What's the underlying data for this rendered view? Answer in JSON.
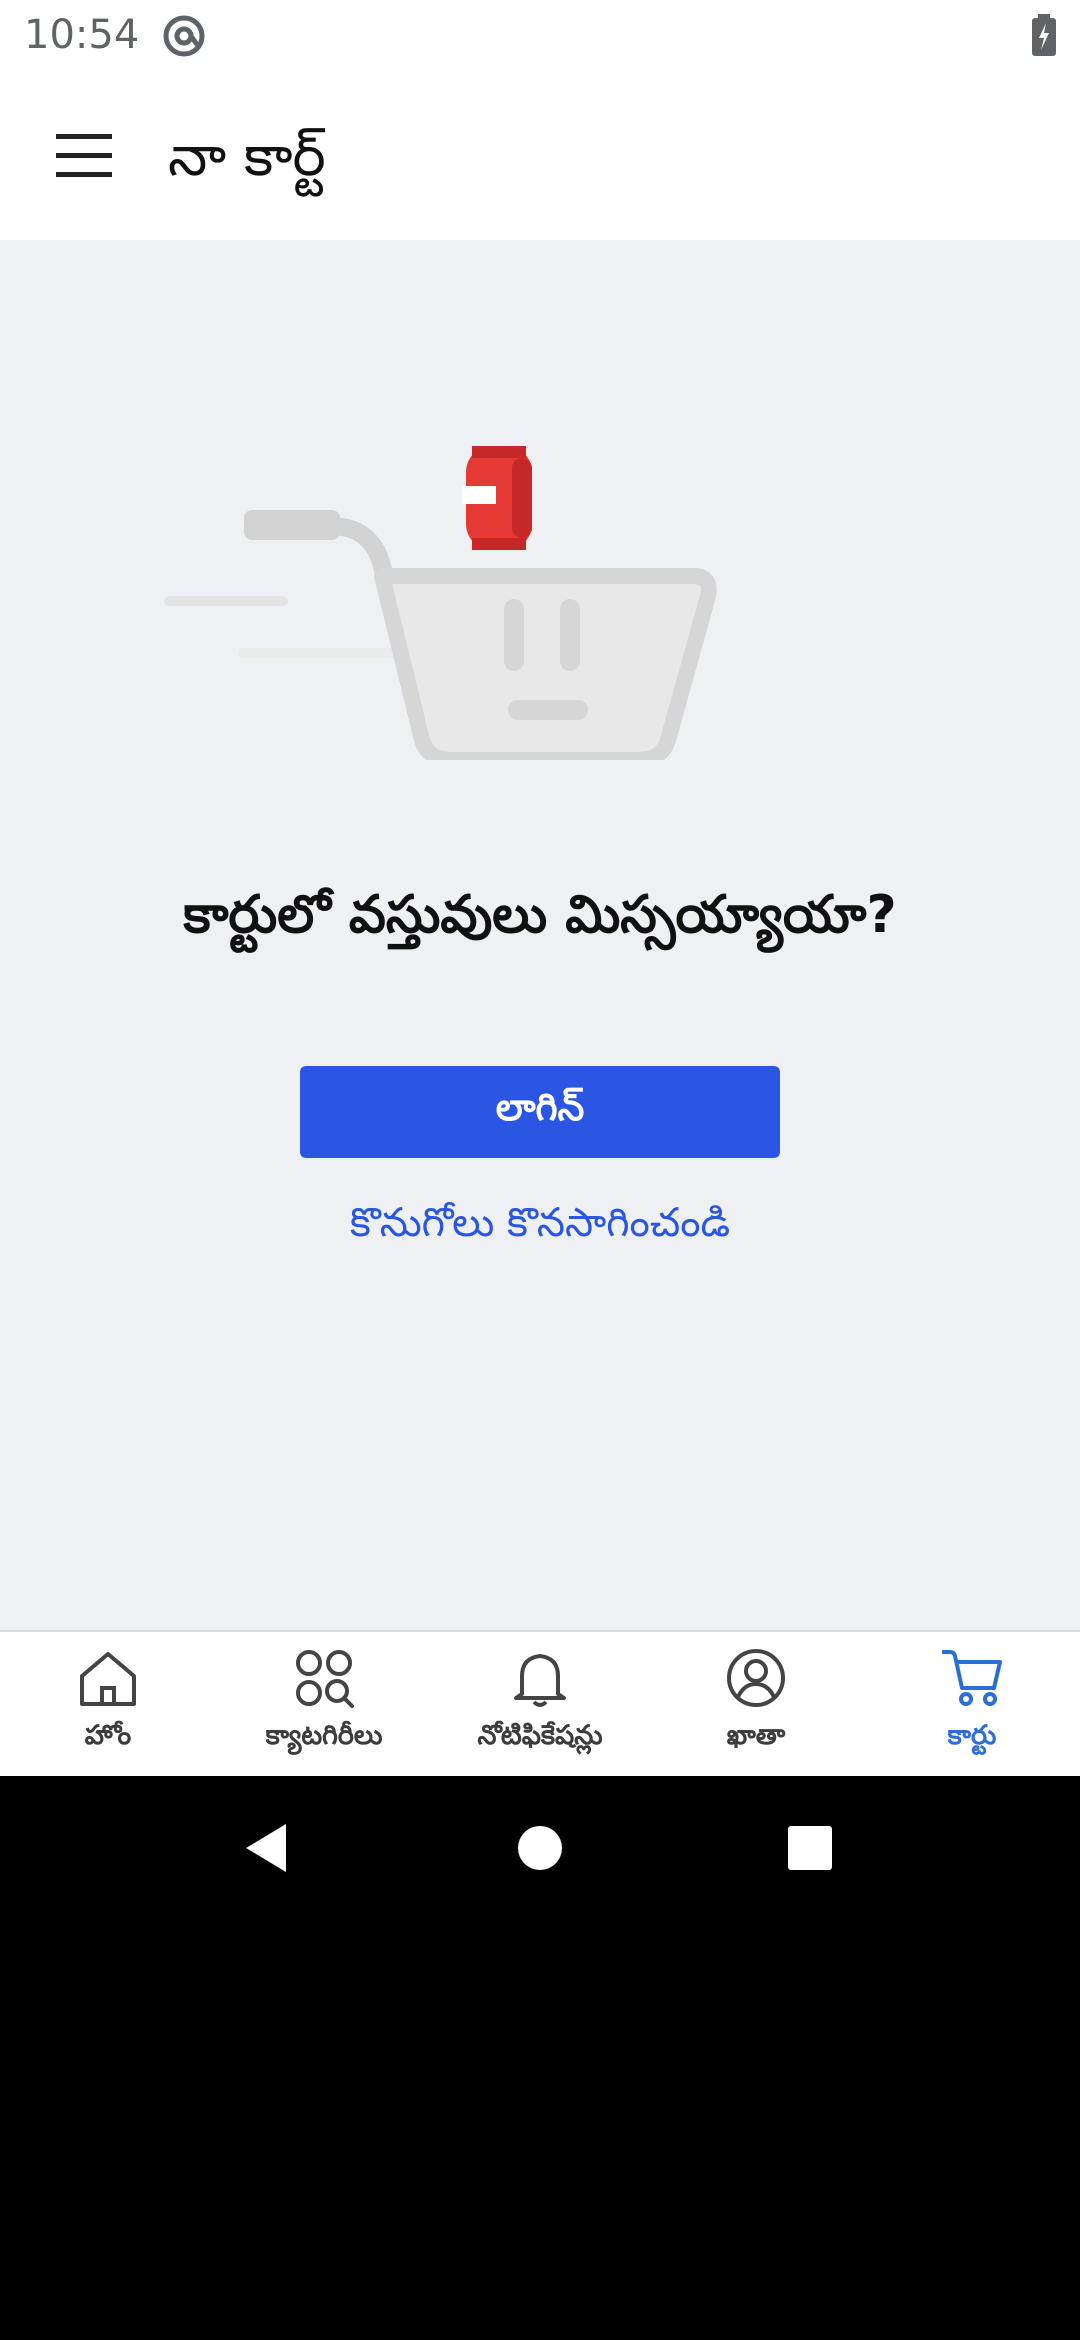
{
  "status_bar": {
    "time": "10:54",
    "app_icon": "at-sign-icon",
    "battery_icon": "battery-charging-icon"
  },
  "app_bar": {
    "menu_icon": "hamburger-menu-icon",
    "title": "నా కార్ట్"
  },
  "empty_state": {
    "illustration": "empty-shopping-cart-illustration",
    "heading": "కార్టులో వస్తువులు మిస్సయ్యాయా?",
    "login_label": "లాగిన్",
    "continue_shopping_label": "కొనుగోలు కొనసాగించండి"
  },
  "bottom_nav": {
    "items": [
      {
        "label": "హోం",
        "icon": "home-icon",
        "active": false
      },
      {
        "label": "క్యాటగిరీలు",
        "icon": "categories-icon",
        "active": false
      },
      {
        "label": "నోటిఫికేషన్లు",
        "icon": "bell-icon",
        "active": false
      },
      {
        "label": "ఖాతా",
        "icon": "account-icon",
        "active": false
      },
      {
        "label": "కార్టు",
        "icon": "cart-icon",
        "active": true
      }
    ]
  },
  "colors": {
    "primary": "#2b56e4",
    "active_nav": "#2b6fd6",
    "background": "#eff0f4",
    "accent_red": "#e53935"
  }
}
